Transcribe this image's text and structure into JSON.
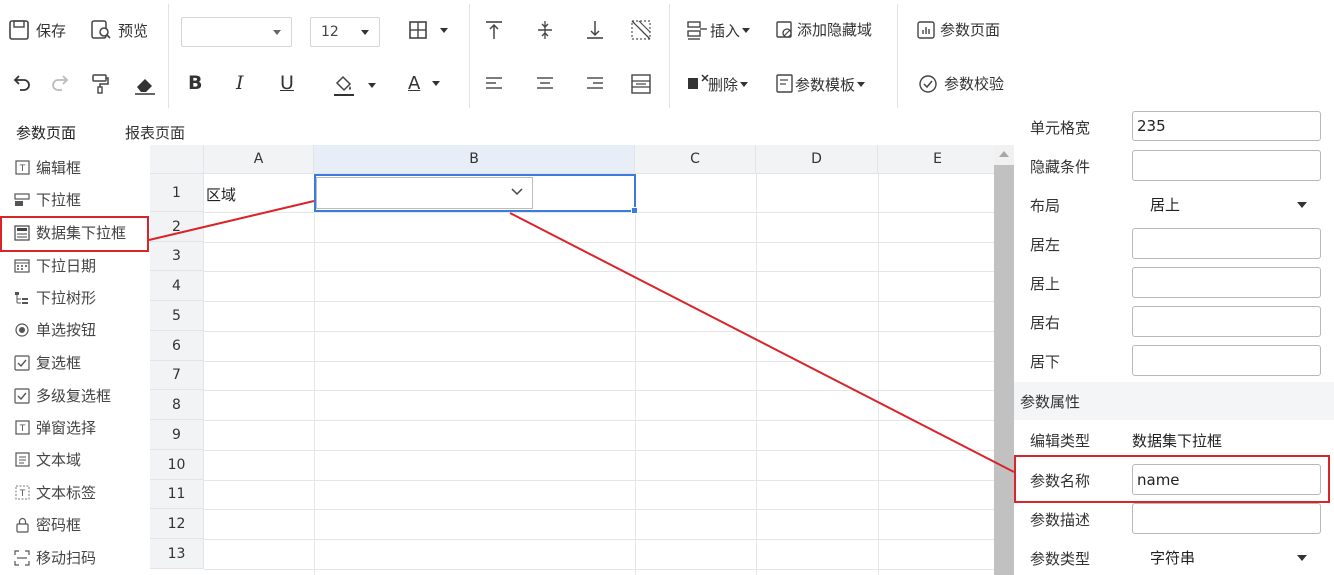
{
  "toolbar": {
    "save_label": "保存",
    "preview_label": "预览",
    "font_family_value": "",
    "font_size_value": "12",
    "insert_label": "插入",
    "add_hidden_region_label": "添加隐藏域",
    "param_page_label": "参数页面",
    "delete_label": "删除",
    "param_template_label": "参数模板",
    "param_check_label": "参数校验",
    "bold_glyph": "B",
    "italic_glyph": "I",
    "underline_glyph": "U",
    "font_color_glyph": "A"
  },
  "tabs": {
    "param_page": "参数页面",
    "report_page": "报表页面"
  },
  "widgets": [
    {
      "label": "编辑框",
      "icon": "text-field-icon"
    },
    {
      "label": "下拉框",
      "icon": "dropdown-icon"
    },
    {
      "label": "数据集下拉框",
      "icon": "dataset-dropdown-icon"
    },
    {
      "label": "下拉日期",
      "icon": "calendar-icon"
    },
    {
      "label": "下拉树形",
      "icon": "tree-icon"
    },
    {
      "label": "单选按钮",
      "icon": "radio-icon"
    },
    {
      "label": "复选框",
      "icon": "checkbox-icon"
    },
    {
      "label": "多级复选框",
      "icon": "multi-checkbox-icon"
    },
    {
      "label": "弹窗选择",
      "icon": "popup-select-icon"
    },
    {
      "label": "文本域",
      "icon": "textarea-icon"
    },
    {
      "label": "文本标签",
      "icon": "text-label-icon"
    },
    {
      "label": "密码框",
      "icon": "lock-icon"
    },
    {
      "label": "移动扫码",
      "icon": "scan-icon"
    }
  ],
  "sheet": {
    "columns": [
      "A",
      "B",
      "C",
      "D",
      "E"
    ],
    "rows": [
      "1",
      "2",
      "3",
      "4",
      "5",
      "6",
      "7",
      "8",
      "9",
      "10",
      "11",
      "12",
      "13"
    ],
    "cell_a1": "区域"
  },
  "properties": {
    "cell_width_label": "单元格宽",
    "cell_width_value": "235",
    "hidden_condition_label": "隐藏条件",
    "hidden_condition_value": "",
    "layout_label": "布局",
    "layout_value": "居上",
    "left_label": "居左",
    "top_label": "居上",
    "right_label": "居右",
    "bottom_label": "居下",
    "section_param_attrs": "参数属性",
    "edit_type_label": "编辑类型",
    "edit_type_value": "数据集下拉框",
    "param_name_label": "参数名称",
    "param_name_value": "name",
    "param_desc_label": "参数描述",
    "param_desc_value": "",
    "param_type_label": "参数类型",
    "param_type_value": "字符串"
  },
  "colors": {
    "selection": "#3b7bdc",
    "annotation": "#d9242a",
    "header_bg": "#f2f3f5"
  }
}
